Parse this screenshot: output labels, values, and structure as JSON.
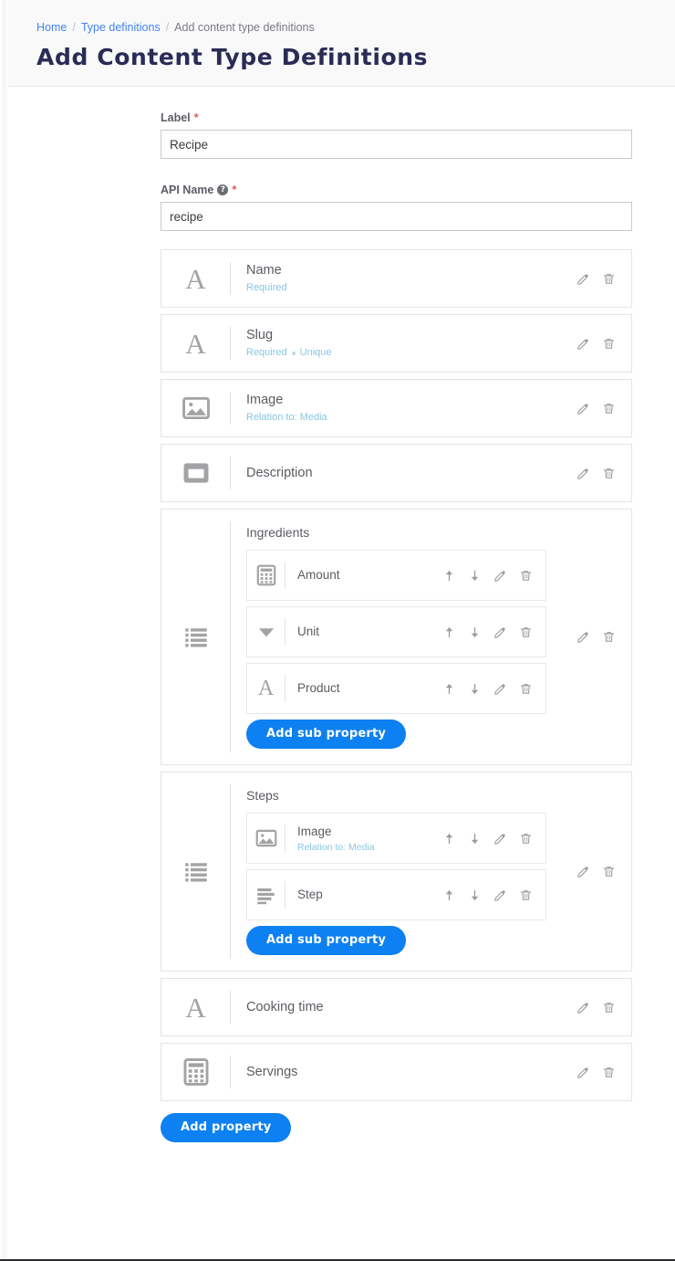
{
  "breadcrumb": {
    "items": [
      {
        "label": "Home",
        "link": true
      },
      {
        "label": "Type definitions",
        "link": true
      },
      {
        "label": "Add content type definitions",
        "link": false
      }
    ],
    "separator": "/"
  },
  "header": {
    "title": "Add Content Type Definitions"
  },
  "fields": {
    "label": {
      "label": "Label",
      "required_marker": "*",
      "value": "Recipe",
      "placeholder": ""
    },
    "api_name": {
      "label": "API Name",
      "help_icon": "help-circle-icon",
      "help_glyph": "?",
      "required_marker": "*",
      "value": "recipe",
      "placeholder": ""
    }
  },
  "colors": {
    "accent_blue": "#0d80f2",
    "link_blue": "#4285f4",
    "meta_blue": "#89c5e0",
    "required_red": "#e35b5b",
    "title_navy": "#2b2b55",
    "card_border": "#e4e4e8",
    "icon_gray": "#a3a3a6"
  },
  "actions": {
    "edit_label": "Edit",
    "delete_label": "Delete",
    "move_up_label": "Move up",
    "move_down_label": "Move down"
  },
  "buttons": {
    "add_property": "Add property",
    "add_sub_property": "Add sub property"
  },
  "properties": [
    {
      "kind": "simple",
      "name": "Name",
      "icon": "text-field-icon",
      "meta": [
        "Required"
      ]
    },
    {
      "kind": "simple",
      "name": "Slug",
      "icon": "text-field-icon",
      "meta": [
        "Required",
        "Unique"
      ]
    },
    {
      "kind": "simple",
      "name": "Image",
      "icon": "image-icon",
      "meta": [
        "Relation to: Media"
      ]
    },
    {
      "kind": "simple",
      "name": "Description",
      "icon": "rich-text-icon",
      "meta": []
    },
    {
      "kind": "group",
      "name": "Ingredients",
      "icon": "list-icon",
      "sub_properties": [
        {
          "name": "Amount",
          "icon": "number-icon",
          "meta": []
        },
        {
          "name": "Unit",
          "icon": "dropdown-icon",
          "meta": []
        },
        {
          "name": "Product",
          "icon": "text-field-icon",
          "meta": []
        }
      ],
      "add_button": "Add sub property"
    },
    {
      "kind": "group",
      "name": "Steps",
      "icon": "list-icon",
      "sub_properties": [
        {
          "name": "Image",
          "icon": "image-icon",
          "meta": [
            "Relation to: Media"
          ]
        },
        {
          "name": "Step",
          "icon": "paragraph-icon",
          "meta": []
        }
      ],
      "add_button": "Add sub property"
    },
    {
      "kind": "simple",
      "name": "Cooking time",
      "icon": "text-field-icon",
      "meta": []
    },
    {
      "kind": "simple",
      "name": "Servings",
      "icon": "number-icon",
      "meta": []
    }
  ]
}
